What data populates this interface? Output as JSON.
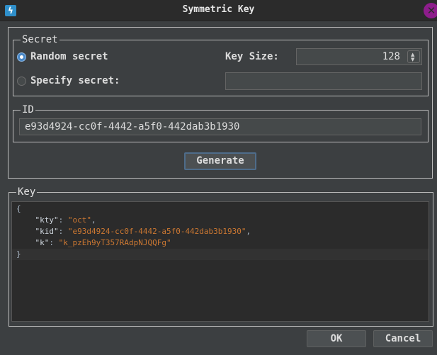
{
  "window": {
    "title": "Symmetric Key",
    "app_icon": "lightning-icon",
    "close_icon": "close-icon"
  },
  "secret": {
    "legend": "Secret",
    "random_label": "Random secret",
    "random_selected": true,
    "specify_label": "Specify secret:",
    "specify_selected": false,
    "specify_value": "",
    "key_size_label": "Key Size:",
    "key_size_value": "128"
  },
  "id": {
    "legend": "ID",
    "value": "e93d4924-cc0f-4442-a5f0-442dab3b1930"
  },
  "generate_label": "Generate",
  "key": {
    "legend": "Key",
    "lines": {
      "open": "{",
      "kty_key": "\"kty\"",
      "kty_val": "\"oct\"",
      "kid_key": "\"kid\"",
      "kid_val": "\"e93d4924-cc0f-4442-a5f0-442dab3b1930\"",
      "k_key": "\"k\"",
      "k_val": "\"k_pzEh9yT357RAdpNJQQFg\"",
      "close": "}"
    }
  },
  "buttons": {
    "ok": "OK",
    "cancel": "Cancel"
  },
  "colors": {
    "accent": "#4a88c7",
    "string": "#cc7832",
    "close": "#8e1d8c"
  }
}
